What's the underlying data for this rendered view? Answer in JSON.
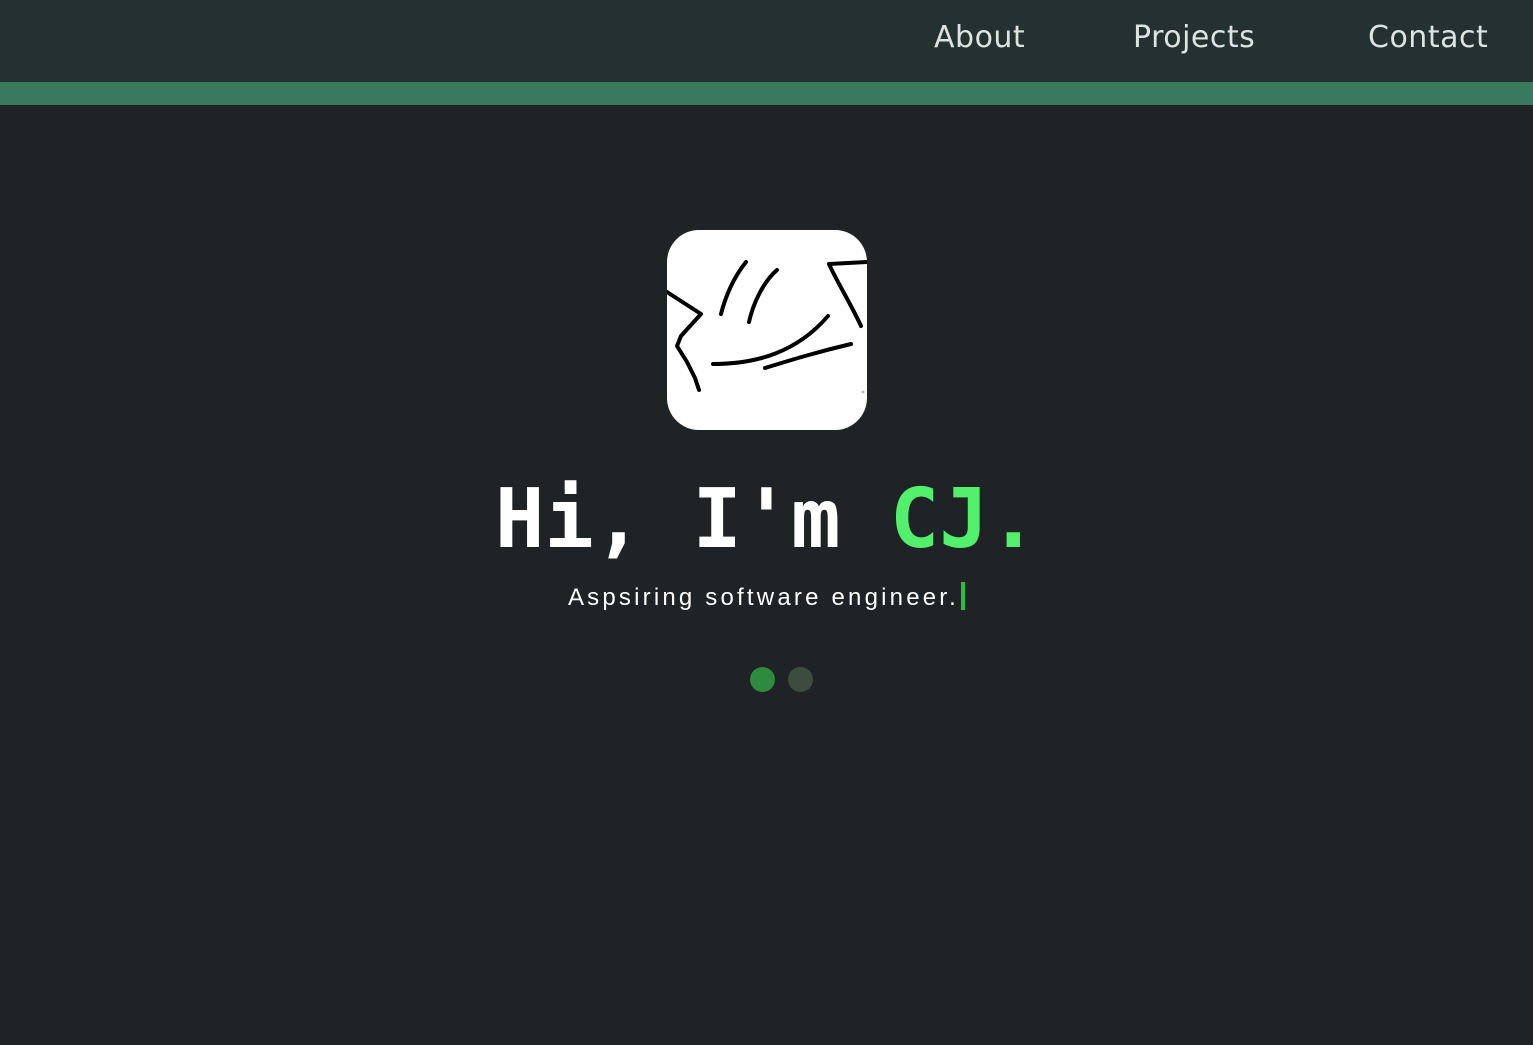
{
  "nav": {
    "links": [
      {
        "label": "About"
      },
      {
        "label": "Projects"
      },
      {
        "label": "Contact"
      }
    ]
  },
  "hero": {
    "greeting": "Hi, I'm ",
    "name": "CJ.",
    "tagline": "Aspsiring software engineer.",
    "logo_icon": "hand-drawn-sketch-icon"
  },
  "carousel": {
    "dot_count": 2,
    "active_index": 0
  },
  "colors": {
    "page_background": "#1f2325",
    "navbar": "#243130",
    "accent_strip": "#397a5e",
    "name_highlight": "#52f06c",
    "cursor": "#2bbf41",
    "dot_active": "#2e8a3e",
    "dot_inactive": "#3c4d3f"
  }
}
